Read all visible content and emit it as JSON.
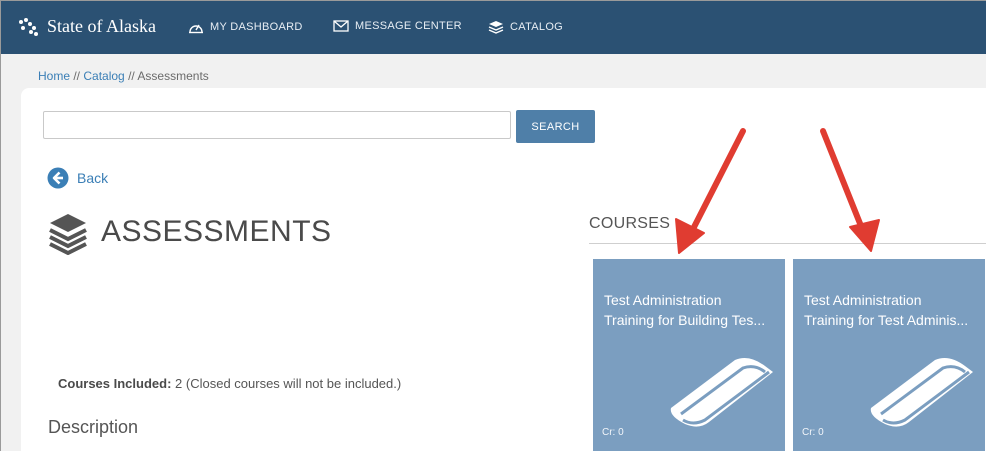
{
  "nav": {
    "brand": "State of Alaska",
    "items": [
      {
        "label": "MY DASHBOARD",
        "icon": "dashboard-icon"
      },
      {
        "label": "MESSAGE CENTER",
        "icon": "envelope-icon"
      },
      {
        "label": "CATALOG",
        "icon": "stack-icon"
      }
    ]
  },
  "breadcrumb": {
    "home": "Home",
    "sep": " // ",
    "catalog": "Catalog",
    "current": "Assessments"
  },
  "search": {
    "value": "",
    "button_label": "SEARCH"
  },
  "back_label": "Back",
  "page_title": "ASSESSMENTS",
  "courses": {
    "heading": "COURSES",
    "cards": [
      {
        "line1": "Test Administration",
        "line2": "Training for Building Tes...",
        "credits": "Cr: 0"
      },
      {
        "line1": "Test Administration",
        "line2": "Training for Test Adminis...",
        "credits": "Cr: 0"
      }
    ]
  },
  "included": {
    "label": "Courses Included:",
    "value": " 2 (Closed courses will not be included.)"
  },
  "description_heading": "Description",
  "colors": {
    "nav_bg": "#2b5173",
    "accent": "#4f7fa8",
    "card_bg": "#7b9ec0",
    "annotation_arrow": "#e03c31"
  }
}
